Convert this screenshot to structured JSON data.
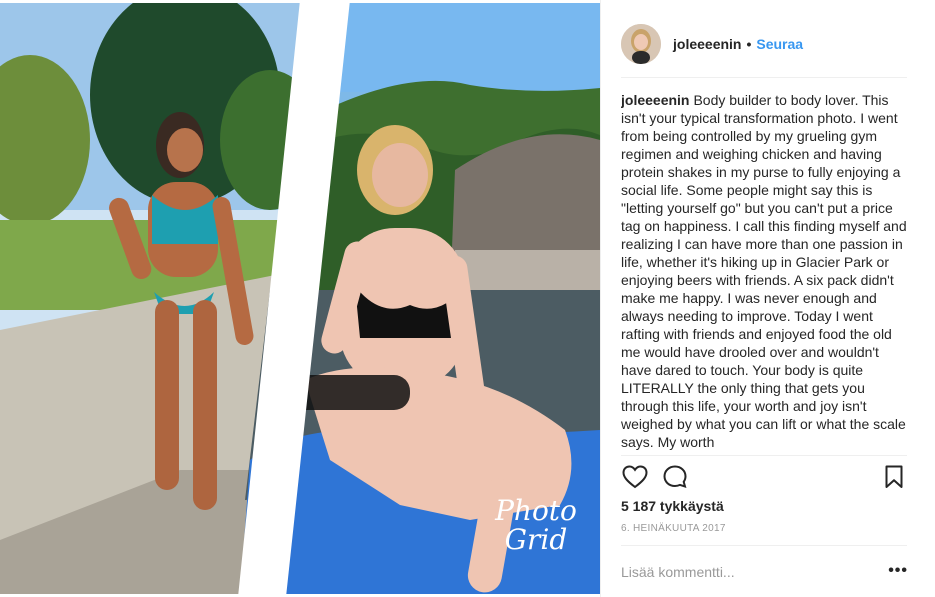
{
  "post": {
    "username": "joleeeenin",
    "dot": "•",
    "follow_label": "Seuraa",
    "caption_user": "joleeeenin",
    "caption_text": "Body builder to body lover. This isn't your typical transformation photo. I went from being controlled by my grueling gym regimen and weighing chicken and having protein shakes in my purse to fully enjoying a social life. Some people might say this is \"letting yourself go\" but you can't put a price tag on happiness. I call this finding myself and realizing I can have more than one passion in life, whether it's hiking up in Glacier Park or enjoying beers with friends. A six pack didn't make me happy. I was never enough and always needing to improve. Today I went rafting with friends and enjoyed food the old me would have drooled over and wouldn't have dared to touch. Your body is quite LITERALLY the only thing that gets you through this life, your worth and joy isn't weighed by what you can lift or what the scale says. My worth",
    "likes": "5 187 tykkäystä",
    "date": "6. HEINÄKUUTA 2017",
    "comment_placeholder": "Lisää kommentti...",
    "more_label": "•••",
    "watermark_line1": "Photo",
    "watermark_line2": "Grid"
  },
  "icons": {
    "like": "heart-icon",
    "comment": "comment-bubble-icon",
    "save": "bookmark-icon",
    "more": "ellipsis-icon"
  },
  "colors": {
    "follow": "#3897f0",
    "text": "#262626",
    "muted": "#999999",
    "divider": "#efefef"
  }
}
